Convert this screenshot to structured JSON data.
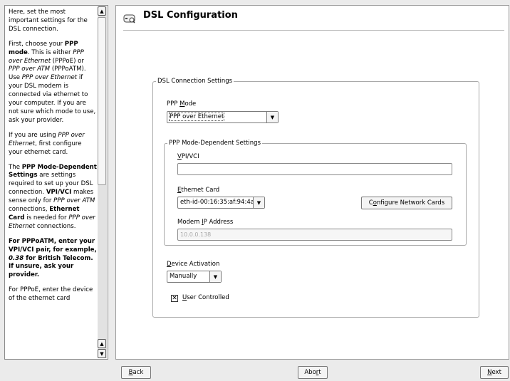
{
  "help": {
    "paragraphs": [
      [
        {
          "t": "Here, set the most important settings for the DSL connection."
        }
      ],
      [
        {
          "t": "First, choose your "
        },
        {
          "t": "PPP mode",
          "b": true
        },
        {
          "t": ". This is either "
        },
        {
          "t": "PPP over Ethernet",
          "i": true
        },
        {
          "t": " (PPPoE) or "
        },
        {
          "t": "PPP over ATM",
          "i": true
        },
        {
          "t": " (PPPoATM). Use "
        },
        {
          "t": "PPP over Ethernet",
          "i": true
        },
        {
          "t": " if your DSL modem is connected via ethernet to your computer. If you are not sure which mode to use, ask your provider."
        }
      ],
      [
        {
          "t": "If you are using "
        },
        {
          "t": "PPP over Ethernet",
          "i": true
        },
        {
          "t": ", first configure your ethernet card."
        }
      ],
      [
        {
          "t": "The "
        },
        {
          "t": "PPP Mode-Dependent Settings",
          "b": true
        },
        {
          "t": " are settings required to set up your DSL connection. "
        },
        {
          "t": "VPI/VCI",
          "b": true
        },
        {
          "t": " makes sense only for "
        },
        {
          "t": "PPP over ATM",
          "i": true
        },
        {
          "t": " connections, "
        },
        {
          "t": "Ethernet Card",
          "b": true
        },
        {
          "t": " is needed for "
        },
        {
          "t": "PPP over Ethernet",
          "i": true
        },
        {
          "t": " connections."
        }
      ],
      [
        {
          "t": "For PPPoATM, enter your VPI/VCI pair, for example, ",
          "b": true
        },
        {
          "t": "0.38",
          "b": true,
          "i": true
        },
        {
          "t": " for British Telecom. If unsure, ask your provider.",
          "b": true
        }
      ],
      [
        {
          "t": "For PPPoE, enter the device of the ethernet card"
        }
      ]
    ]
  },
  "header": {
    "title": "DSL Configuration",
    "icon": "dsl-modem-icon"
  },
  "dsl_settings": {
    "legend": "DSL Connection Settings",
    "ppp_mode": {
      "label_pre": "PPP ",
      "label_key": "M",
      "label_post": "ode",
      "value": "PPP over Ethernet"
    },
    "dependent": {
      "legend": "PPP Mode-Dependent Settings",
      "vpi_vci": {
        "label_key": "V",
        "label_post": "PI/VCI",
        "value": ""
      },
      "ethernet_card": {
        "label_key": "E",
        "label_post": "thernet Card",
        "value": "eth-id-00:16:35:af:94:4a"
      },
      "configure_button": {
        "pre": "C",
        "key": "o",
        "post": "nfigure Network Cards"
      },
      "modem_ip": {
        "label_pre": "Modem ",
        "label_key": "I",
        "label_post": "P Address",
        "value": "10.0.0.138"
      }
    },
    "device_activation": {
      "label_key": "D",
      "label_post": "evice Activation",
      "value": "Manually"
    },
    "user_controlled": {
      "label_key": "U",
      "label_post": "ser Controlled",
      "checked": true
    }
  },
  "footer": {
    "back": {
      "key": "B",
      "post": "ack"
    },
    "abort": {
      "pre": "Abo",
      "key": "r",
      "post": "t"
    },
    "next": {
      "key": "N",
      "post": "ext"
    }
  }
}
